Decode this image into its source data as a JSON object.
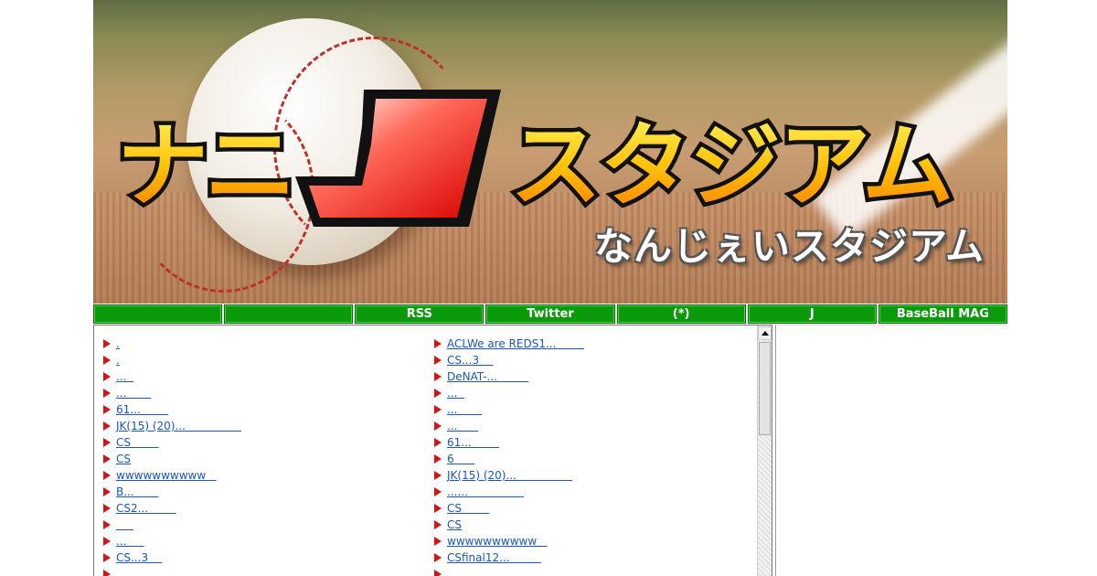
{
  "banner": {
    "logo_main": "ナニJスタジアム",
    "logo_sub": "なんじぇいスタジアム"
  },
  "nav": {
    "items": [
      {
        "label": ""
      },
      {
        "label": ""
      },
      {
        "label": "RSS"
      },
      {
        "label": "Twitter"
      },
      {
        "label": "(*)"
      },
      {
        "label": "J"
      },
      {
        "label": "BaseBall MAG"
      }
    ]
  },
  "content": {
    "left_links": [
      ".",
      ".",
      "...  ",
      "...       ",
      "61...        ",
      "JK(15) (20)...                ",
      "CS        ",
      "CS",
      "wwwwwwwwww   ",
      "B...       ",
      "CS2...        ",
      "     ",
      "...     ",
      "CS...3    ",
      "..."
    ],
    "right_links": [
      "ACLWe are REDS1...        ",
      "CS...3    ",
      "DeNAT-...         ",
      "...  ",
      "...       ",
      "...      ",
      "61...        ",
      "6      ",
      "JK(15) (20)...                ",
      "......                ",
      "CS        ",
      "CS",
      "wwwwwwwwww   ",
      "CSfinal12...         ",
      "..."
    ]
  },
  "colors": {
    "nav_green": "#0b9a0b",
    "link_blue": "#1a57b8",
    "arrow_red": "#d41515"
  },
  "icons": {
    "bullet": "red-triangle-arrow-icon",
    "scroll_up": "scroll-up-arrow-icon"
  }
}
